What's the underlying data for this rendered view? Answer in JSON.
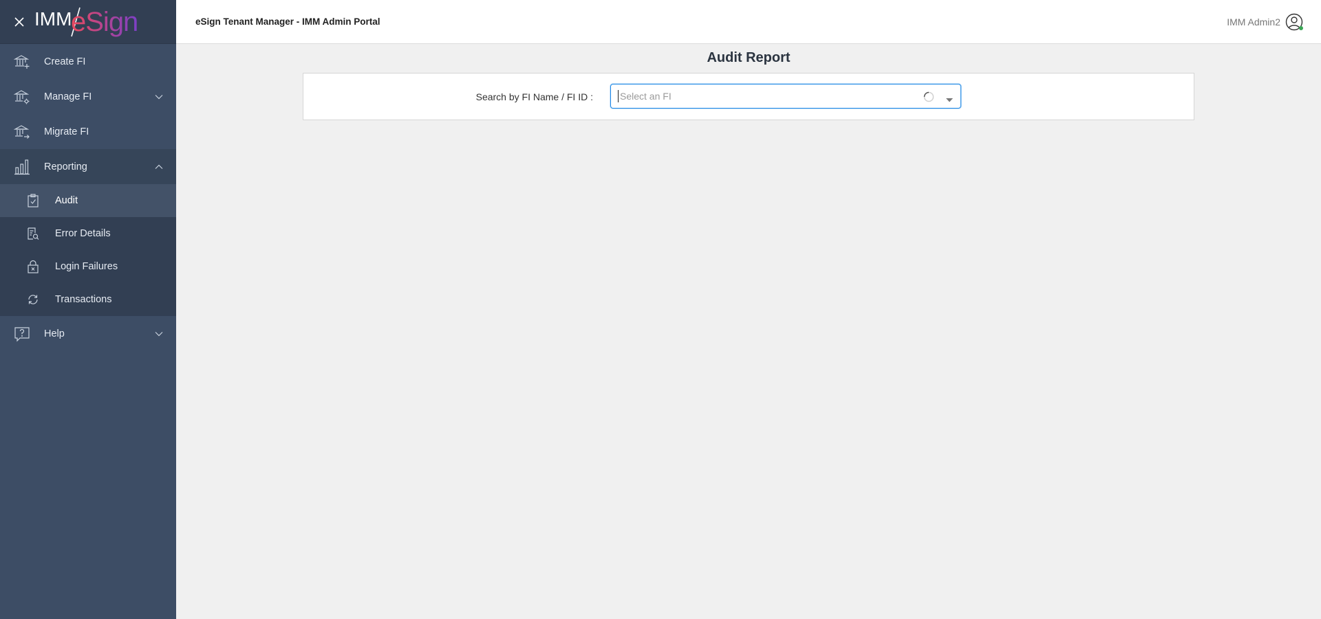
{
  "app": {
    "portal_title": "eSign Tenant Manager - IMM Admin Portal",
    "user_name": "IMM Admin2",
    "logo_left": "IMM",
    "logo_right": "eSign"
  },
  "sidebar": {
    "items": [
      {
        "label": "Create FI",
        "icon": "bank-plus-icon"
      },
      {
        "label": "Manage FI",
        "icon": "bank-gear-icon",
        "chevron": "down"
      },
      {
        "label": "Migrate FI",
        "icon": "bank-arrow-icon"
      },
      {
        "label": "Reporting",
        "icon": "bar-chart-icon",
        "chevron": "up",
        "expanded": true
      },
      {
        "label": "Help",
        "icon": "help-bubble-icon",
        "chevron": "down"
      }
    ],
    "reporting_subitems": [
      {
        "label": "Audit",
        "icon": "clipboard-check-icon",
        "active": true
      },
      {
        "label": "Error Details",
        "icon": "doc-search-icon"
      },
      {
        "label": "Login Failures",
        "icon": "lock-x-icon"
      },
      {
        "label": "Transactions",
        "icon": "cycle-arrows-icon"
      }
    ]
  },
  "main": {
    "page_title": "Audit Report",
    "search_label": "Search by FI Name / FI ID :",
    "select_placeholder": "Select an FI",
    "select_value": ""
  },
  "colors": {
    "sidebar_bg": "#3d4d65",
    "sidebar_header_bg": "#323f53",
    "active_item_bg": "#435268",
    "focus_border": "#1e88e5",
    "logo_esign_start": "#e8495f",
    "logo_esign_end": "#7b3fc4",
    "status_online": "#3aa655"
  }
}
